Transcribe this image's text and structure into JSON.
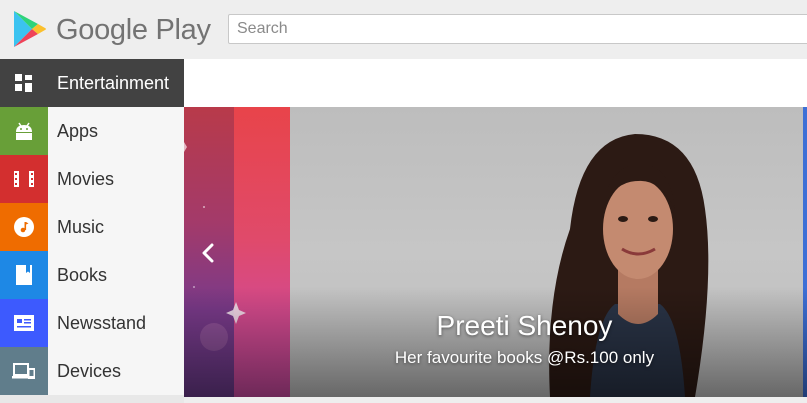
{
  "header": {
    "brand": "Google Play",
    "search_placeholder": "Search"
  },
  "sidebar": {
    "items": [
      {
        "label": "Entertainment",
        "icon": "grid-icon",
        "color": "#424242",
        "active": true
      },
      {
        "label": "Apps",
        "icon": "android-icon",
        "color": "#689f38"
      },
      {
        "label": "Movies",
        "icon": "film-icon",
        "color": "#d32f2f"
      },
      {
        "label": "Music",
        "icon": "music-note-icon",
        "color": "#ef6c00"
      },
      {
        "label": "Books",
        "icon": "book-icon",
        "color": "#1e88e5"
      },
      {
        "label": "Newsstand",
        "icon": "newspaper-icon",
        "color": "#3d5afe"
      },
      {
        "label": "Devices",
        "icon": "devices-icon",
        "color": "#607d8b"
      }
    ]
  },
  "banner": {
    "title": "Preeti Shenoy",
    "subtitle": "Her favourite books @Rs.100 only"
  }
}
